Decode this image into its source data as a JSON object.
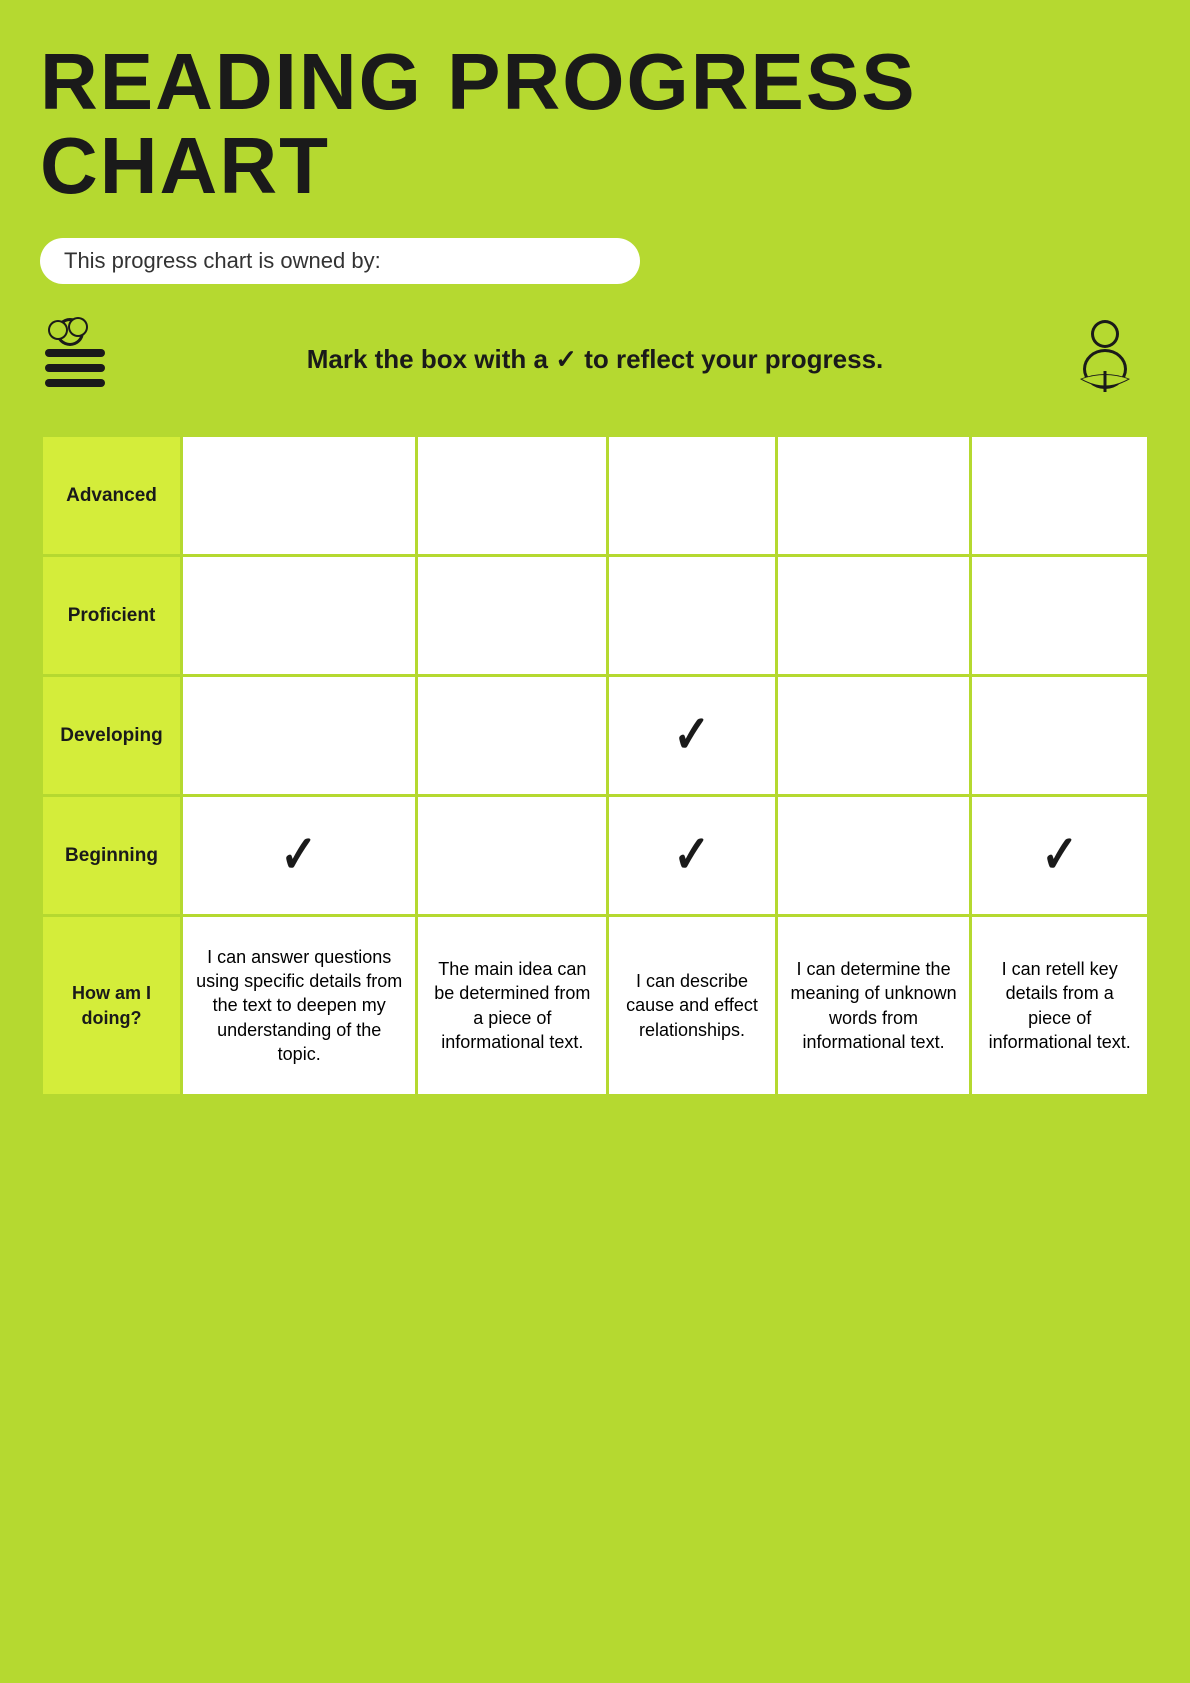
{
  "title": "READING PROGRESS CHART",
  "owner_label": "This progress chart is owned by:",
  "instruction": "Mark the box with a ✓ to reflect your progress.",
  "rows": [
    {
      "label": "Advanced",
      "checks": [
        false,
        false,
        false,
        false,
        false
      ]
    },
    {
      "label": "Proficient",
      "checks": [
        false,
        false,
        false,
        false,
        false
      ]
    },
    {
      "label": "Developing",
      "checks": [
        false,
        false,
        true,
        false,
        false
      ]
    },
    {
      "label": "Beginning",
      "checks": [
        true,
        false,
        true,
        false,
        true
      ]
    }
  ],
  "how_label": "How am I doing?",
  "descriptors": [
    "I can answer questions using specific details from the text to deepen my understanding of the topic.",
    "The main idea can be determined from a piece of informational text.",
    "I can describe cause and effect relationships.",
    "I can determine the meaning of unknown words from informational text.",
    "I can retell key details from a piece of informational text."
  ]
}
